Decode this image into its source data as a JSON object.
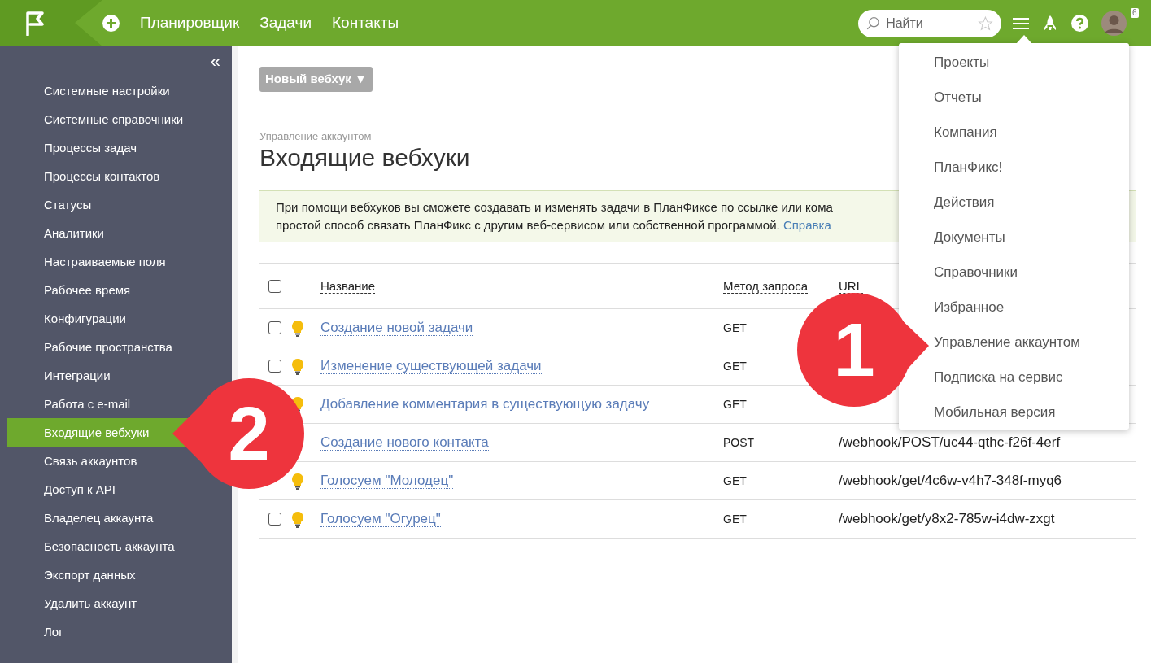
{
  "topbar": {
    "nav": [
      "Планировщик",
      "Задачи",
      "Контакты"
    ],
    "search": {
      "placeholder": "Найти"
    },
    "notification_count": "6"
  },
  "sidebar": {
    "collapse": "«",
    "items": [
      {
        "label": "Системные настройки",
        "selected": false
      },
      {
        "label": "Системные справочники",
        "selected": false
      },
      {
        "label": "Процессы задач",
        "selected": false
      },
      {
        "label": "Процессы контактов",
        "selected": false
      },
      {
        "label": "Статусы",
        "selected": false
      },
      {
        "label": "Аналитики",
        "selected": false
      },
      {
        "label": "Настраиваемые поля",
        "selected": false
      },
      {
        "label": "Рабочее время",
        "selected": false
      },
      {
        "label": "Конфигурации",
        "selected": false
      },
      {
        "label": "Рабочие пространства",
        "selected": false
      },
      {
        "label": "Интеграции",
        "selected": false
      },
      {
        "label": "Работа с e-mail",
        "selected": false
      },
      {
        "label": "Входящие вебхуки",
        "selected": true
      },
      {
        "label": "Связь аккаунтов",
        "selected": false
      },
      {
        "label": "Доступ к API",
        "selected": false
      },
      {
        "label": "Владелец аккаунта",
        "selected": false
      },
      {
        "label": "Безопасность аккаунта",
        "selected": false
      },
      {
        "label": "Экспорт данных",
        "selected": false
      },
      {
        "label": "Удалить аккаунт",
        "selected": false
      },
      {
        "label": "Лог",
        "selected": false
      }
    ]
  },
  "new_button": "Новый вебхук ▼",
  "breadcrumb": "Управление аккаунтом",
  "title": "Входящие вебхуки",
  "info": {
    "line1": "При помощи вебхуков вы сможете создавать и изменять задачи в ПланФиксе по ссылке или кома",
    "line2": "простой способ связать ПланФикс с другим веб-сервисом или собственной программой.",
    "link": "Справка"
  },
  "table": {
    "columns": [
      "Название",
      "Метод запроса",
      "URL"
    ],
    "header_checked": false,
    "rows": [
      {
        "name": "Создание новой задачи",
        "method": "GET",
        "checked": false,
        "lightbulb": true
      },
      {
        "name": "Изменение существующей задачи",
        "method": "GET",
        "checked": false,
        "lightbulb": true
      },
      {
        "name": "Добавление комментария в существующую задачу",
        "method": "GET",
        "lightbulb": true
      },
      {
        "name": "Создание нового контакта",
        "method": "POST",
        "url": "/webhook/POST/uc44-qthc-f26f-4erf"
      },
      {
        "name": "Голосуем \"Молодец\"",
        "method": "GET",
        "url": "/webhook/get/4c6w-v4h7-348f-myq6",
        "lightbulb": true
      },
      {
        "name": "Голосуем \"Огурец\"",
        "method": "GET",
        "url": "/webhook/get/y8x2-785w-i4dw-zxgt",
        "checked": false,
        "lightbulb": true
      }
    ]
  },
  "menu": {
    "items": [
      "Проекты",
      "Отчеты",
      "Компания",
      "ПланФикс!",
      "Действия",
      "Документы",
      "Справочники",
      "Избранное",
      "Управление аккаунтом",
      "Подписка на сервис",
      "Мобильная версия"
    ]
  },
  "callouts": [
    {
      "label": "1",
      "kind": "right"
    },
    {
      "label": "2",
      "kind": "left"
    }
  ]
}
